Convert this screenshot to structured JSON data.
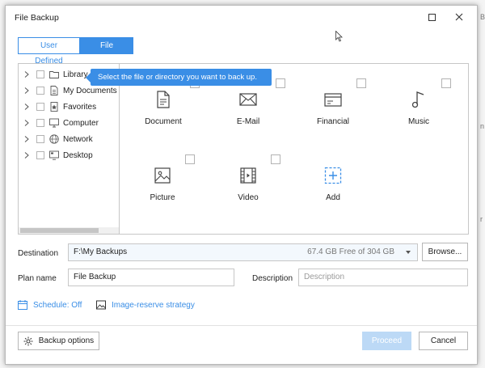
{
  "window": {
    "title": "File Backup"
  },
  "tabs": [
    {
      "label": "User Defined",
      "active": false
    },
    {
      "label": "File Type",
      "active": true
    }
  ],
  "tree": {
    "items": [
      {
        "label": "Library",
        "icon": "folder-icon"
      },
      {
        "label": "My Documents",
        "icon": "document-icon"
      },
      {
        "label": "Favorites",
        "icon": "favorites-icon"
      },
      {
        "label": "Computer",
        "icon": "computer-icon"
      },
      {
        "label": "Network",
        "icon": "network-icon"
      },
      {
        "label": "Desktop",
        "icon": "desktop-icon"
      }
    ]
  },
  "tooltip": "Select the file or directory you want to back up.",
  "file_types": [
    {
      "label": "Document",
      "icon": "document-icon"
    },
    {
      "label": "E-Mail",
      "icon": "email-icon"
    },
    {
      "label": "Financial",
      "icon": "financial-icon"
    },
    {
      "label": "Music",
      "icon": "music-icon"
    },
    {
      "label": "Picture",
      "icon": "picture-icon"
    },
    {
      "label": "Video",
      "icon": "video-icon"
    },
    {
      "label": "Add",
      "icon": "add-icon"
    }
  ],
  "destination": {
    "label": "Destination",
    "value": "F:\\My Backups",
    "free_space": "67.4 GB Free of 304 GB",
    "browse_label": "Browse..."
  },
  "plan": {
    "label": "Plan name",
    "value": "File Backup",
    "description_label": "Description",
    "description_placeholder": "Description"
  },
  "links": {
    "schedule": "Schedule: Off",
    "image_reserve": "Image-reserve strategy"
  },
  "footer": {
    "backup_options": "Backup options",
    "proceed": "Proceed",
    "cancel": "Cancel"
  },
  "background": {
    "texts": [
      "Br",
      "n",
      "r"
    ]
  },
  "colors": {
    "accent": "#3a8ee6",
    "proceed_disabled": "#bcd9f6"
  }
}
